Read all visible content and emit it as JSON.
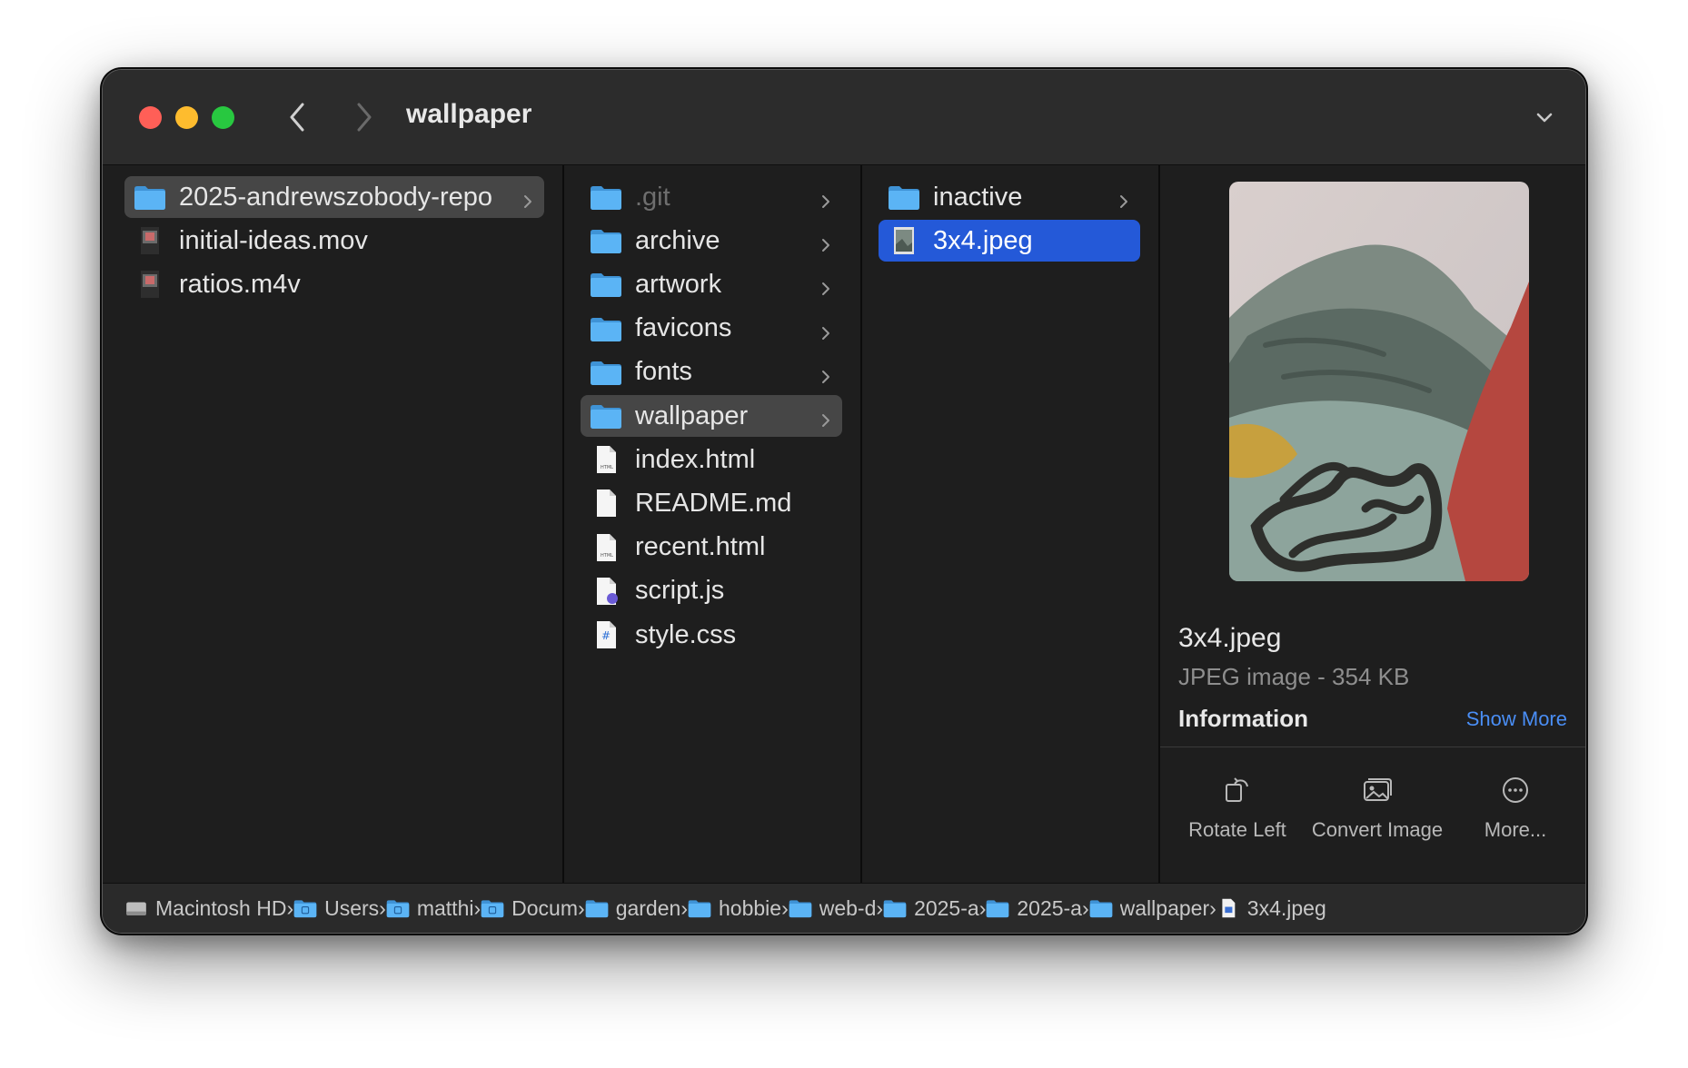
{
  "window": {
    "title": "wallpaper"
  },
  "columns": {
    "col1": [
      {
        "label": "2025-andrewszobody-repo",
        "icon": "folder-icon",
        "selected": "inactive",
        "has_children": true
      },
      {
        "label": "initial-ideas.mov",
        "icon": "video-thumbnail-icon",
        "selected": "none",
        "has_children": false
      },
      {
        "label": "ratios.m4v",
        "icon": "video-thumbnail-icon",
        "selected": "none",
        "has_children": false
      }
    ],
    "col2": [
      {
        "label": ".git",
        "icon": "folder-icon",
        "dim": true,
        "has_children": true
      },
      {
        "label": "archive",
        "icon": "folder-icon",
        "has_children": true
      },
      {
        "label": "artwork",
        "icon": "folder-icon",
        "has_children": true
      },
      {
        "label": "favicons",
        "icon": "folder-icon",
        "has_children": true
      },
      {
        "label": "fonts",
        "icon": "folder-icon",
        "has_children": true
      },
      {
        "label": "wallpaper",
        "icon": "folder-icon",
        "selected": "inactive",
        "has_children": true
      },
      {
        "label": "index.html",
        "icon": "html-file-icon",
        "has_children": false
      },
      {
        "label": "README.md",
        "icon": "document-icon",
        "has_children": false
      },
      {
        "label": "recent.html",
        "icon": "html-file-icon",
        "has_children": false
      },
      {
        "label": "script.js",
        "icon": "js-file-icon",
        "has_children": false
      },
      {
        "label": "style.css",
        "icon": "css-file-icon",
        "has_children": false
      }
    ],
    "col3": [
      {
        "label": "inactive",
        "icon": "folder-icon",
        "has_children": true
      },
      {
        "label": "3x4.jpeg",
        "icon": "image-thumbnail-icon",
        "selected": "active",
        "has_children": false
      }
    ]
  },
  "preview": {
    "file_name": "3x4.jpeg",
    "kind": "JPEG image - 354 KB",
    "info_heading": "Information",
    "show_more": "Show More",
    "actions": [
      {
        "label": "Rotate Left",
        "icon": "rotate-left-icon"
      },
      {
        "label": "Convert Image",
        "icon": "convert-image-icon"
      },
      {
        "label": "More...",
        "icon": "more-ellipsis-icon"
      }
    ]
  },
  "pathbar": [
    {
      "label": "Macintosh HD",
      "icon": "hard-drive-icon"
    },
    {
      "label": "Users",
      "icon": "users-folder-icon"
    },
    {
      "label": "matthi",
      "icon": "home-folder-icon"
    },
    {
      "label": "Docum",
      "icon": "documents-folder-icon"
    },
    {
      "label": "garden",
      "icon": "folder-icon"
    },
    {
      "label": "hobbie",
      "icon": "folder-icon"
    },
    {
      "label": "web-d",
      "icon": "folder-icon"
    },
    {
      "label": "2025-a",
      "icon": "folder-icon"
    },
    {
      "label": "2025-a",
      "icon": "folder-icon"
    },
    {
      "label": "wallpaper",
      "icon": "folder-icon"
    },
    {
      "label": "3x4.jpeg",
      "icon": "image-file-icon"
    }
  ],
  "colors": {
    "accent": "#2459d8",
    "folder": "#5bb4f5",
    "link": "#4a8ef5",
    "close": "#ff5f57",
    "minimize": "#febc2e",
    "maximize": "#28c840"
  }
}
